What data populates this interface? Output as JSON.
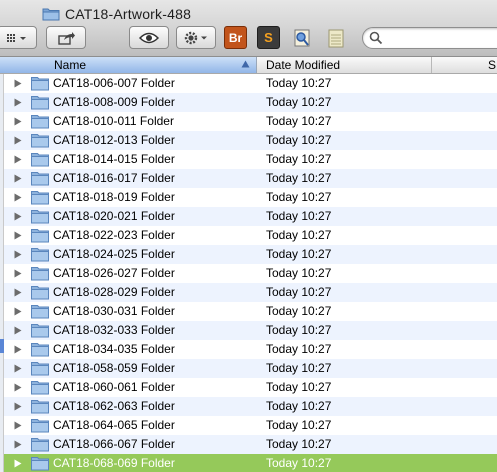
{
  "window": {
    "title": "CAT18-Artwork-488"
  },
  "toolbar": {
    "apps": [
      {
        "name": "bridge-app-icon",
        "label": "Br",
        "color": "#c2541b"
      },
      {
        "name": "sublime-app-icon",
        "label": "S",
        "color": "#3b3b3b"
      },
      {
        "name": "preview-app-icon",
        "label": "",
        "color": "#5b8ed6"
      },
      {
        "name": "notes-app-icon",
        "label": "",
        "color": "#e9e5c9"
      }
    ]
  },
  "columns": {
    "name": "Name",
    "date": "Date Modified",
    "size": "S"
  },
  "rows": [
    {
      "name": "CAT18-006-007 Folder",
      "date": "Today 10:27"
    },
    {
      "name": "CAT18-008-009 Folder",
      "date": "Today 10:27"
    },
    {
      "name": "CAT18-010-011 Folder",
      "date": "Today 10:27"
    },
    {
      "name": "CAT18-012-013 Folder",
      "date": "Today 10:27"
    },
    {
      "name": "CAT18-014-015 Folder",
      "date": "Today 10:27"
    },
    {
      "name": "CAT18-016-017 Folder",
      "date": "Today 10:27"
    },
    {
      "name": "CAT18-018-019 Folder",
      "date": "Today 10:27"
    },
    {
      "name": "CAT18-020-021 Folder",
      "date": "Today 10:27"
    },
    {
      "name": "CAT18-022-023 Folder",
      "date": "Today 10:27"
    },
    {
      "name": "CAT18-024-025 Folder",
      "date": "Today 10:27"
    },
    {
      "name": "CAT18-026-027 Folder",
      "date": "Today 10:27"
    },
    {
      "name": "CAT18-028-029 Folder",
      "date": "Today 10:27"
    },
    {
      "name": "CAT18-030-031 Folder",
      "date": "Today 10:27"
    },
    {
      "name": "CAT18-032-033 Folder",
      "date": "Today 10:27"
    },
    {
      "name": "CAT18-034-035 Folder",
      "date": "Today 10:27"
    },
    {
      "name": "CAT18-058-059 Folder",
      "date": "Today 10:27"
    },
    {
      "name": "CAT18-060-061 Folder",
      "date": "Today 10:27"
    },
    {
      "name": "CAT18-062-063 Folder",
      "date": "Today 10:27"
    },
    {
      "name": "CAT18-064-065 Folder",
      "date": "Today 10:27"
    },
    {
      "name": "CAT18-066-067 Folder",
      "date": "Today 10:27"
    },
    {
      "name": "CAT18-068-069 Folder",
      "date": "Today 10:27",
      "selected": true
    }
  ],
  "colors": {
    "selection": "#95c95a",
    "alternate_row": "#edf3fe",
    "sort_header": "#92b6e8"
  }
}
